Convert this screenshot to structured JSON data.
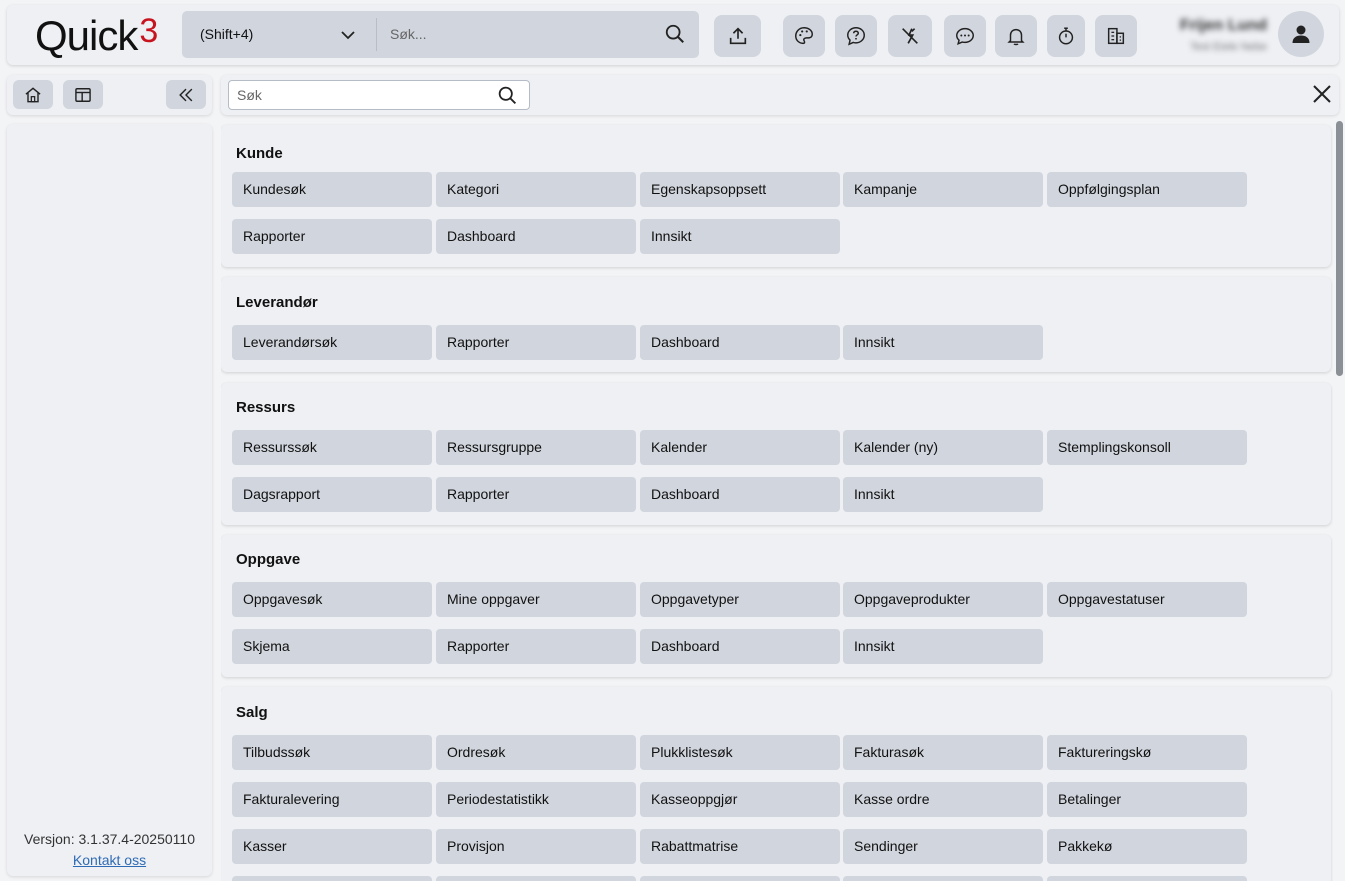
{
  "header": {
    "logo_text": "Quick",
    "logo_sup": "3",
    "shortcut": "(Shift+4)",
    "search_placeholder": "Søk...",
    "user_name": "Frijen Lund",
    "user_sub": "Test Eiele Nebe"
  },
  "icons": [
    "upload-icon",
    "palette-icon",
    "help-icon",
    "unplug-icon",
    "chat-icon",
    "bell-icon",
    "timer-icon",
    "building-icon"
  ],
  "sidebar": {
    "version": "Versjon: 3.1.37.4-20250110",
    "contact": "Kontakt oss"
  },
  "menu": {
    "search_placeholder": "Søk",
    "sections": [
      {
        "title": "Kunde",
        "items": [
          "Kundesøk",
          "Kategori",
          "Egenskapsoppsett",
          "Kampanje",
          "Oppfølgingsplan",
          "Rapporter",
          "Dashboard",
          "Innsikt"
        ]
      },
      {
        "title": "Leverandør",
        "items": [
          "Leverandørsøk",
          "Rapporter",
          "Dashboard",
          "Innsikt"
        ]
      },
      {
        "title": "Ressurs",
        "items": [
          "Ressurssøk",
          "Ressursgruppe",
          "Kalender",
          "Kalender (ny)",
          "Stemplingskonsoll",
          "Dagsrapport",
          "Rapporter",
          "Dashboard",
          "Innsikt"
        ]
      },
      {
        "title": "Oppgave",
        "items": [
          "Oppgavesøk",
          "Mine oppgaver",
          "Oppgavetyper",
          "Oppgaveprodukter",
          "Oppgavestatuser",
          "Skjema",
          "Rapporter",
          "Dashboard",
          "Innsikt"
        ]
      },
      {
        "title": "Salg",
        "items": [
          "Tilbudssøk",
          "Ordresøk",
          "Plukklistesøk",
          "Fakturasøk",
          "Faktureringskø",
          "Fakturalevering",
          "Periodestatistikk",
          "Kasseoppgjør",
          "Kasse ordre",
          "Betalinger",
          "Kasser",
          "Provisjon",
          "Rabattmatrise",
          "Sendinger",
          "Pakkekø",
          "",
          "",
          "",
          "",
          ""
        ]
      }
    ]
  }
}
